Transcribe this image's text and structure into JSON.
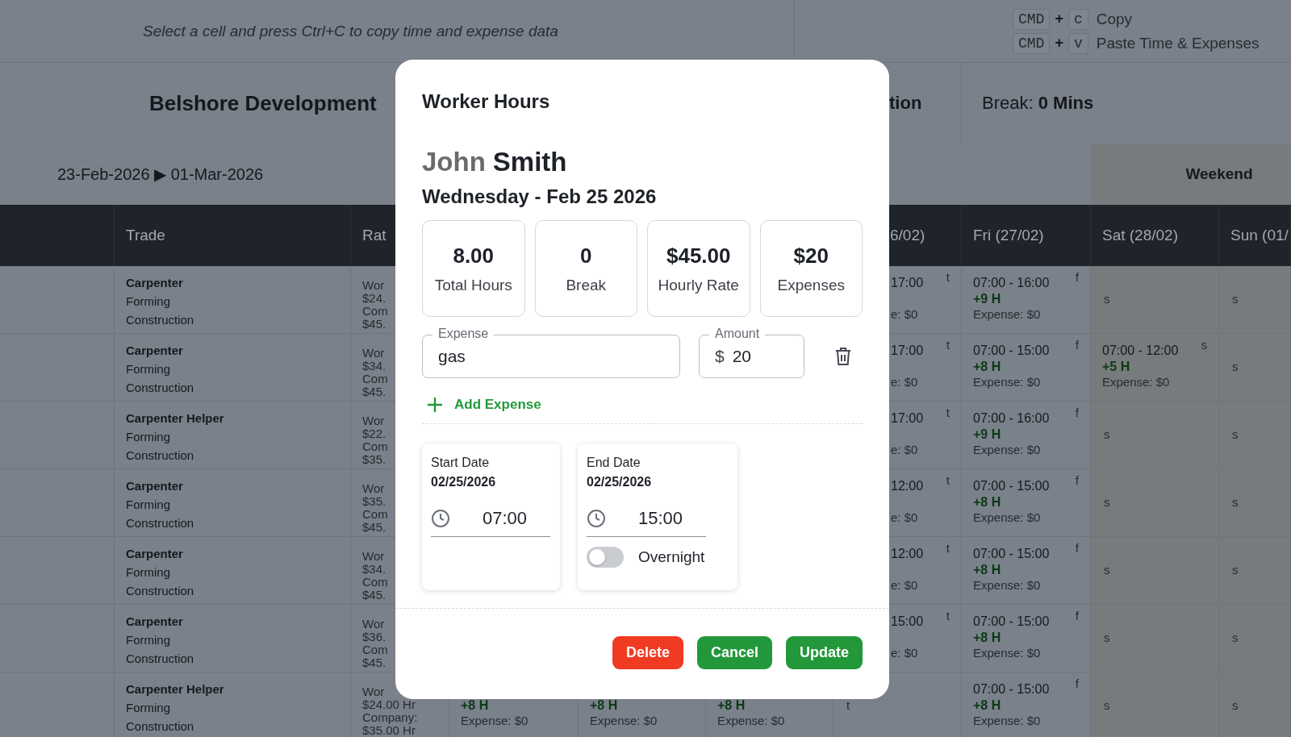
{
  "top_bar": {
    "hint": "Select a cell and press Ctrl+C to copy time and expense data",
    "shortcuts": [
      {
        "key": "CMD",
        "plus": "+",
        "letter": "c",
        "label": "Copy"
      },
      {
        "key": "CMD",
        "plus": "+",
        "letter": "v",
        "label": "Paste Time & Expenses"
      }
    ]
  },
  "header": {
    "company": "Belshore Development",
    "project": "tion",
    "break": "Break: **0 Mins**"
  },
  "period": {
    "range": "23-Feb-2026 ▶ 01-Mar-2026",
    "weekend": "Weekend"
  },
  "table": {
    "columns": [
      {
        "label": "Trade"
      },
      {
        "label": "Rat"
      },
      {
        "label": "6/02)"
      },
      {
        "label": "Fri (27/02)"
      },
      {
        "label": "Sat (28/02)"
      },
      {
        "label": "Sun (01/"
      }
    ],
    "rows": [
      {
        "trade": "Carpenter",
        "category": "Forming",
        "division": "Construction",
        "rate": [
          "Wor",
          "$24.",
          "Com",
          "$45."
        ],
        "thu": {
          "time": "17:00",
          "expense": "e: $0",
          "marker": "t"
        },
        "fri": {
          "time": "07:00 - 16:00",
          "hours": "+9 H",
          "expense": "Expense: $0",
          "marker": "f"
        },
        "sat": {
          "marker": "s"
        },
        "sun": {
          "marker": "s"
        }
      },
      {
        "trade": "Carpenter",
        "category": "Forming",
        "division": "Construction",
        "rate": [
          "Wor",
          "$34.",
          "Com",
          "$45."
        ],
        "thu": {
          "time": "17:00",
          "expense": "e: $0",
          "marker": "t"
        },
        "fri": {
          "time": "07:00 - 15:00",
          "hours": "+8 H",
          "expense": "Expense: $0",
          "marker": "f"
        },
        "sat": {
          "time": "07:00 - 12:00",
          "hours": "+5 H",
          "expense": "Expense: $0",
          "marker": "s"
        },
        "sun": {
          "marker": "s"
        }
      },
      {
        "trade": "Carpenter Helper",
        "category": "Forming",
        "division": "Construction",
        "rate": [
          "Wor",
          "$22.",
          "Com",
          "$35."
        ],
        "thu": {
          "time": "17:00",
          "expense": "e: $0",
          "marker": "t"
        },
        "fri": {
          "time": "07:00 - 16:00",
          "hours": "+9 H",
          "expense": "Expense: $0",
          "marker": "f"
        },
        "sat": {
          "marker": "s"
        },
        "sun": {
          "marker": "s"
        }
      },
      {
        "trade": "Carpenter",
        "category": "Forming",
        "division": "Construction",
        "rate": [
          "Wor",
          "$35.",
          "Com",
          "$45."
        ],
        "thu": {
          "time": "12:00",
          "expense": "e: $0",
          "marker": "t"
        },
        "fri": {
          "time": "07:00 - 15:00",
          "hours": "+8 H",
          "expense": "Expense: $0",
          "marker": "f"
        },
        "sat": {
          "marker": "s"
        },
        "sun": {
          "marker": "s"
        }
      },
      {
        "trade": "Carpenter",
        "category": "Forming",
        "division": "Construction",
        "rate": [
          "Wor",
          "$34.",
          "Com",
          "$45."
        ],
        "thu": {
          "time": "12:00",
          "expense": "e: $0",
          "marker": "t"
        },
        "fri": {
          "time": "07:00 - 15:00",
          "hours": "+8 H",
          "expense": "Expense: $0",
          "marker": "f"
        },
        "sat": {
          "marker": "s"
        },
        "sun": {
          "marker": "s"
        }
      },
      {
        "trade": "Carpenter",
        "category": "Forming",
        "division": "Construction",
        "rate": [
          "Wor",
          "$36.",
          "Com",
          "$45."
        ],
        "thu": {
          "time": "15:00",
          "expense": "e: $0",
          "marker": "t"
        },
        "fri": {
          "time": "07:00 - 15:00",
          "hours": "+8 H",
          "expense": "Expense: $0",
          "marker": "f"
        },
        "sat": {
          "marker": "s"
        },
        "sun": {
          "marker": "s"
        }
      },
      {
        "trade": "Carpenter Helper",
        "category": "Forming",
        "division": "Construction",
        "rate": [
          "Wor",
          "$24.00 Hr",
          "Company:",
          "$35.00 Hr"
        ],
        "mon": {
          "hours": "+8 H",
          "expense": "Expense: $0"
        },
        "tue": {
          "hours": "+8 H",
          "expense": "Expense: $0"
        },
        "wed": {
          "hours": "+8 H",
          "expense": "Expense: $0"
        },
        "thu": {
          "marker": "t"
        },
        "fri": {
          "time": "07:00 - 15:00",
          "hours": "+8 H",
          "expense": "Expense: $0",
          "marker": "f"
        },
        "sat": {
          "marker": "s"
        },
        "sun": {
          "marker": "s"
        }
      }
    ]
  },
  "modal": {
    "title": "Worker Hours",
    "first_name": "John",
    "last_name": "Smith",
    "date": "Wednesday - Feb 25 2026",
    "stats": [
      {
        "value": "8.00",
        "label": "Total Hours"
      },
      {
        "value": "0",
        "label": "Break"
      },
      {
        "value": "$45.00",
        "label": "Hourly Rate"
      },
      {
        "value": "$20",
        "label": "Expenses"
      }
    ],
    "expenses": [
      {
        "label": "Expense",
        "value": "gas",
        "amount_label": "Amount",
        "currency": "$",
        "amount": "20"
      }
    ],
    "add_expense": "Add Expense",
    "start": {
      "label": "Start Date",
      "date": "02/25/2026",
      "time": "07:00"
    },
    "end": {
      "label": "End Date",
      "date": "02/25/2026",
      "time": "15:00"
    },
    "overnight": {
      "label": "Overnight",
      "on": false
    },
    "buttons": [
      {
        "label": "Delete",
        "kind": "danger"
      },
      {
        "label": "Cancel",
        "kind": "confirm"
      },
      {
        "label": "Update",
        "kind": "confirm"
      }
    ]
  }
}
